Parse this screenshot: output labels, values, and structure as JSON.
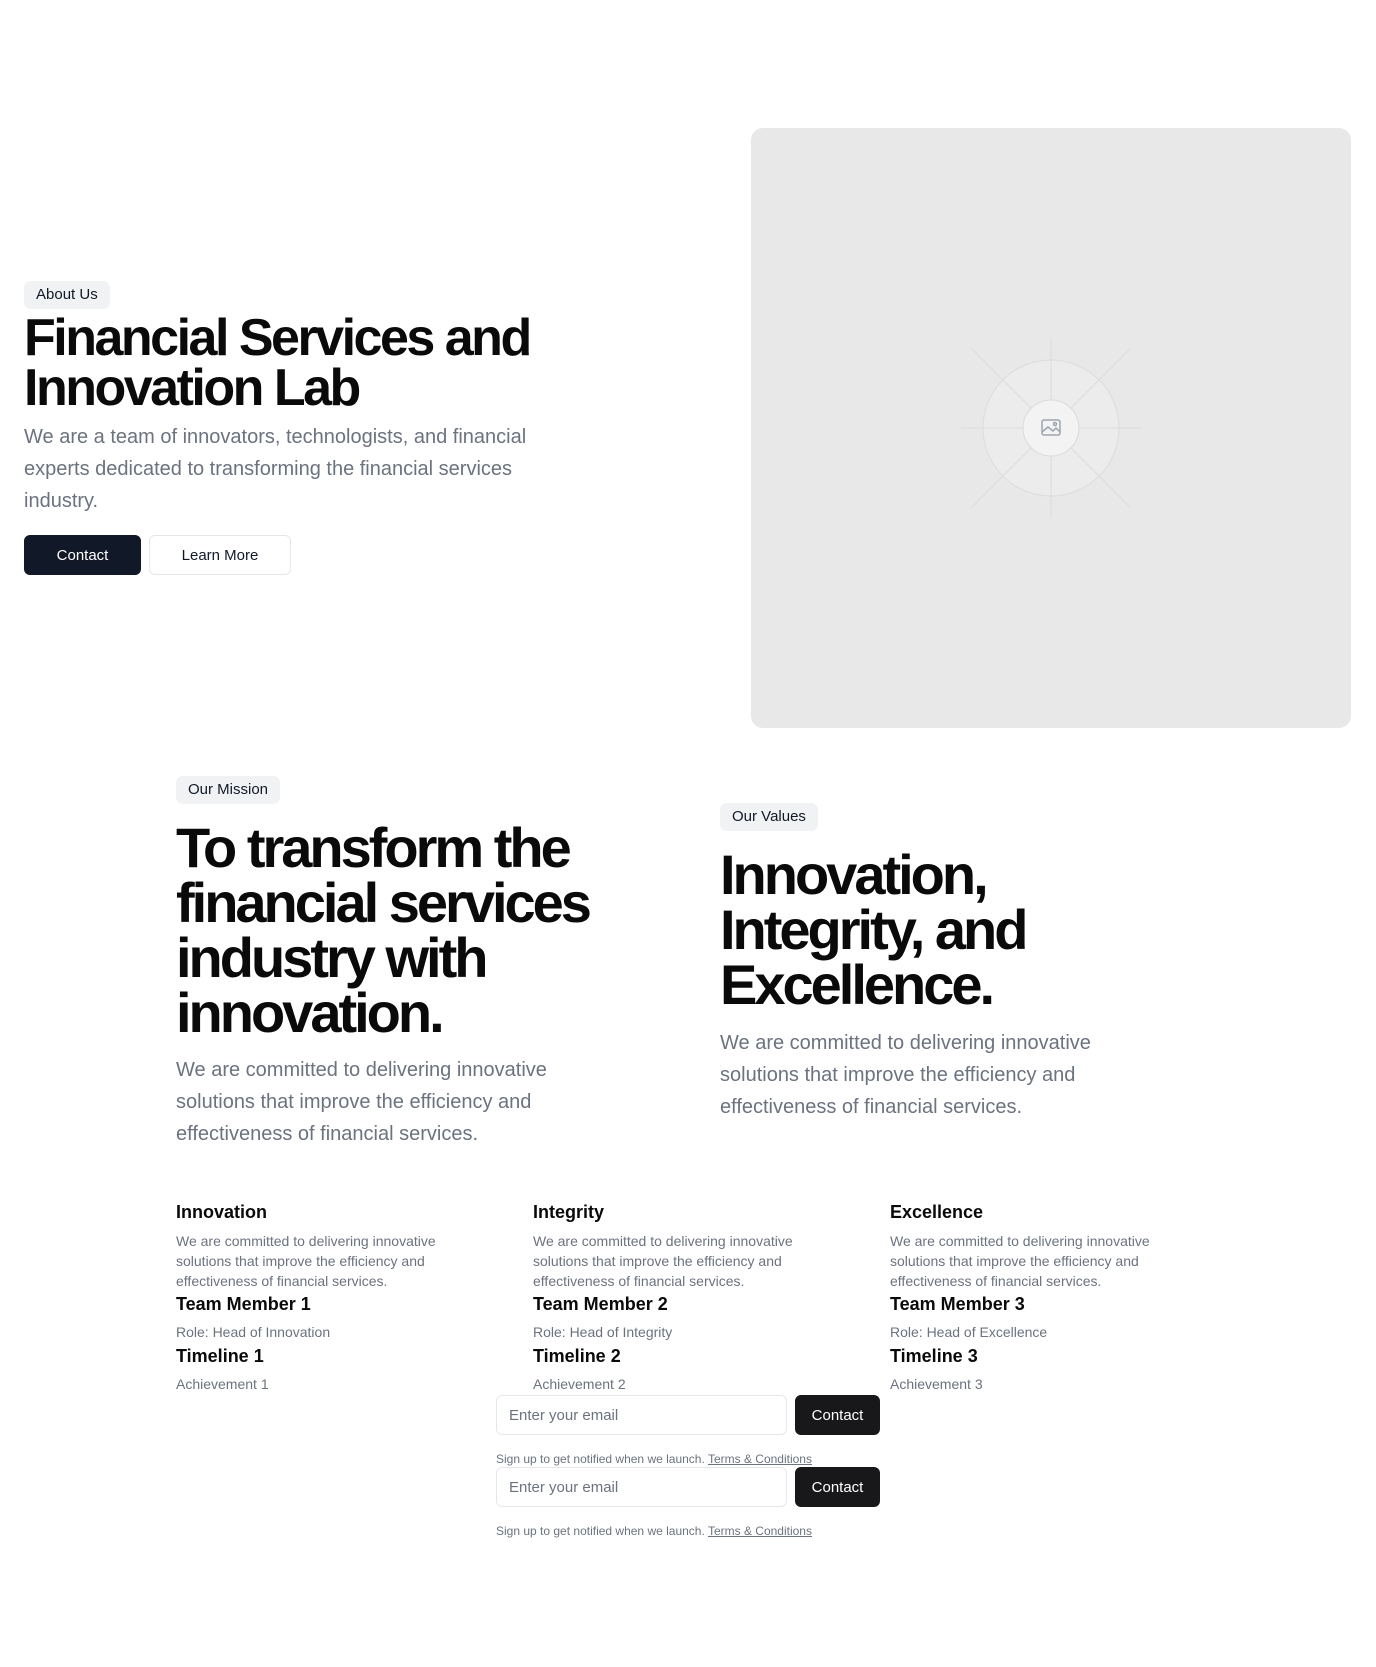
{
  "hero": {
    "badge": "About Us",
    "title": "Financial Services and Innovation Lab",
    "description": "We are a team of innovators, technologists, and financial experts dedicated to transforming the financial services industry.",
    "contact_label": "Contact",
    "learn_more_label": "Learn More",
    "image_icon": "image-placeholder-icon"
  },
  "mission": {
    "badge": "Our Mission",
    "title": "To transform the financial services industry with innovation.",
    "description": "We are committed to delivering innovative solutions that improve the efficiency and effectiveness of financial services."
  },
  "values": {
    "badge": "Our Values",
    "title": "Innovation, Integrity, and Excellence.",
    "description": "We are committed to delivering innovative solutions that improve the efficiency and effectiveness of financial services."
  },
  "columns": [
    {
      "heading": "Innovation",
      "description": "We are committed to delivering innovative solutions that improve the efficiency and effectiveness of financial services.",
      "member": "Team Member 1",
      "role": "Role: Head of Innovation",
      "timeline": "Timeline 1",
      "achievement": "Achievement 1"
    },
    {
      "heading": "Integrity",
      "description": "We are committed to delivering innovative solutions that improve the efficiency and effectiveness of financial services.",
      "member": "Team Member 2",
      "role": "Role: Head of Integrity",
      "timeline": "Timeline 2",
      "achievement": "Achievement 2"
    },
    {
      "heading": "Excellence",
      "description": "We are committed to delivering innovative solutions that improve the efficiency and effectiveness of financial services.",
      "member": "Team Member 3",
      "role": "Role: Head of Excellence",
      "timeline": "Timeline 3",
      "achievement": "Achievement 3"
    }
  ],
  "signups": [
    {
      "placeholder": "Enter your email",
      "button_label": "Contact",
      "note": "Sign up to get notified when we launch.",
      "link_label": "Terms & Conditions"
    },
    {
      "placeholder": "Enter your email",
      "button_label": "Contact",
      "note": "Sign up to get notified when we launch.",
      "link_label": "Terms & Conditions"
    }
  ]
}
